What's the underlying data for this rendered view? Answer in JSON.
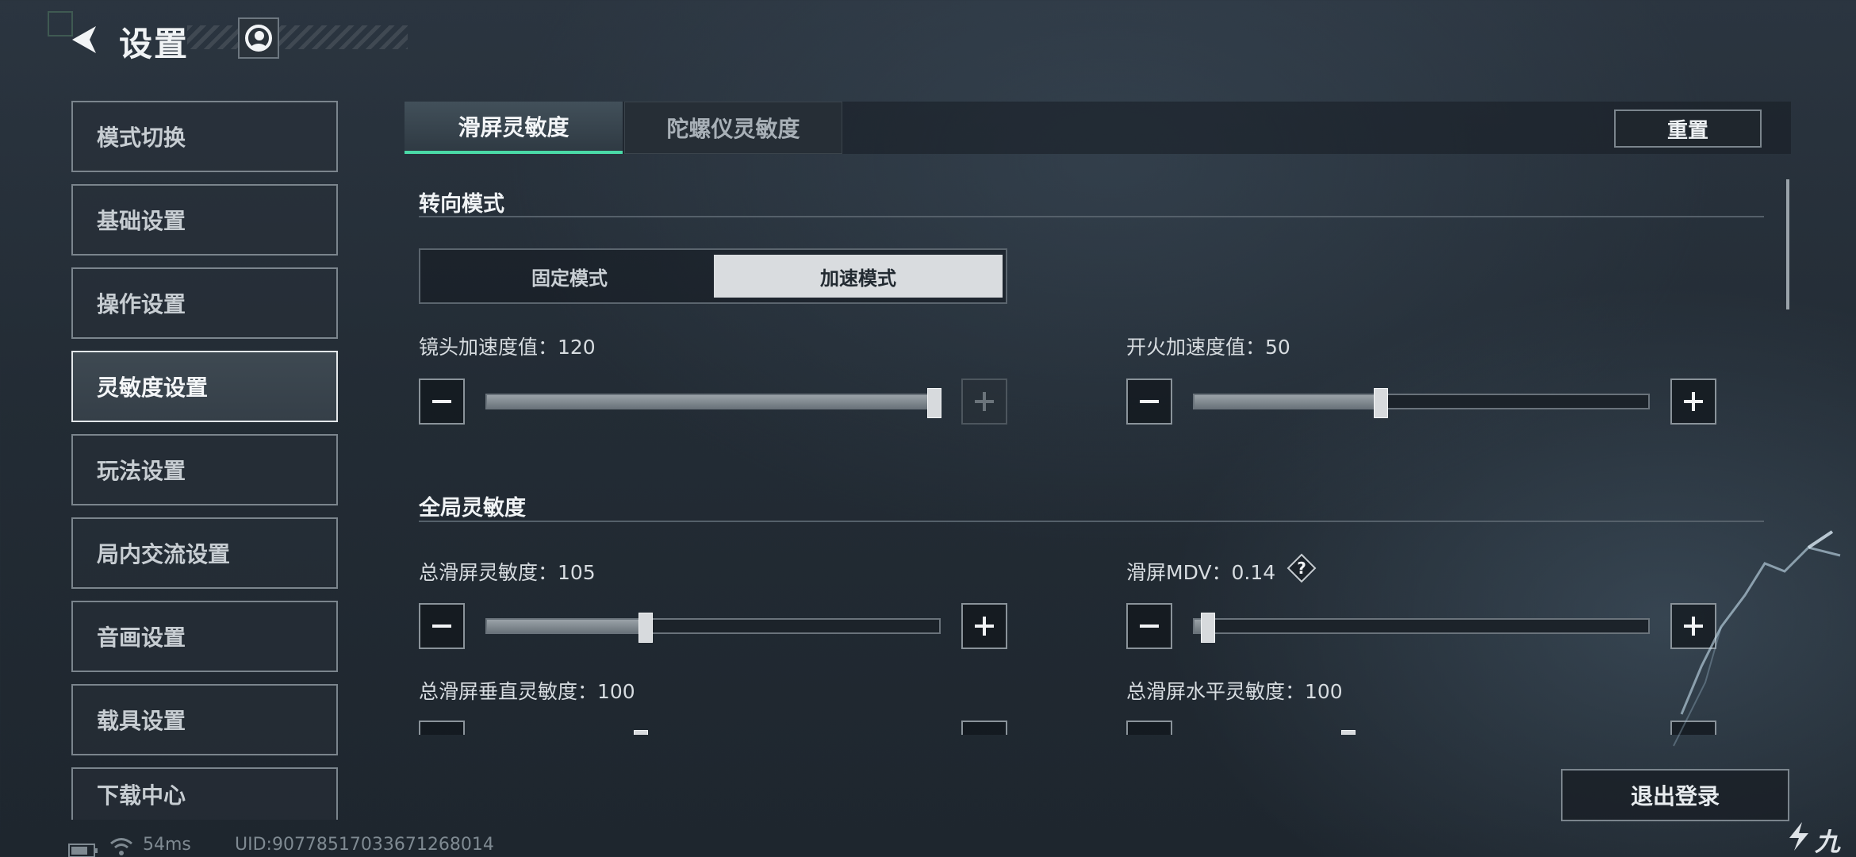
{
  "header": {
    "title": "设置"
  },
  "sidebar": {
    "items": [
      {
        "label": "模式切换"
      },
      {
        "label": "基础设置"
      },
      {
        "label": "操作设置"
      },
      {
        "label": "灵敏度设置"
      },
      {
        "label": "玩法设置"
      },
      {
        "label": "局内交流设置"
      },
      {
        "label": "音画设置"
      },
      {
        "label": "载具设置"
      },
      {
        "label": "下载中心"
      }
    ],
    "active_index": 3
  },
  "tabs": [
    {
      "label": "滑屏灵敏度",
      "active": true
    },
    {
      "label": "陀螺仪灵敏度",
      "active": false
    }
  ],
  "reset_label": "重置",
  "steer_mode": {
    "title": "转向模式",
    "options": [
      {
        "label": "固定模式",
        "selected": false
      },
      {
        "label": "加速模式",
        "selected": true
      }
    ]
  },
  "sliders": {
    "camera_accel": {
      "label": "镜头加速度值：120",
      "fraction": 0.99
    },
    "fire_accel": {
      "label": "开火加速度值：50",
      "fraction": 0.41
    },
    "global_title": "全局灵敏度",
    "total_swipe": {
      "label": "总滑屏灵敏度：105",
      "fraction": 0.35
    },
    "swipe_mdv": {
      "label": "滑屏MDV：0.14",
      "fraction": 0.03,
      "help": "?"
    },
    "total_vertical": {
      "label": "总滑屏垂直灵敏度：100",
      "fraction": 0.34
    },
    "total_horizontal": {
      "label": "总滑屏水平灵敏度：100",
      "fraction": 0.34
    }
  },
  "logout_label": "退出登录",
  "status": {
    "ping": "54ms",
    "uid": "UID:90778517033671268014"
  },
  "watermark": "九游",
  "colors": {
    "accent": "#4ad9a6",
    "active_fill": "#d9dcdf"
  }
}
